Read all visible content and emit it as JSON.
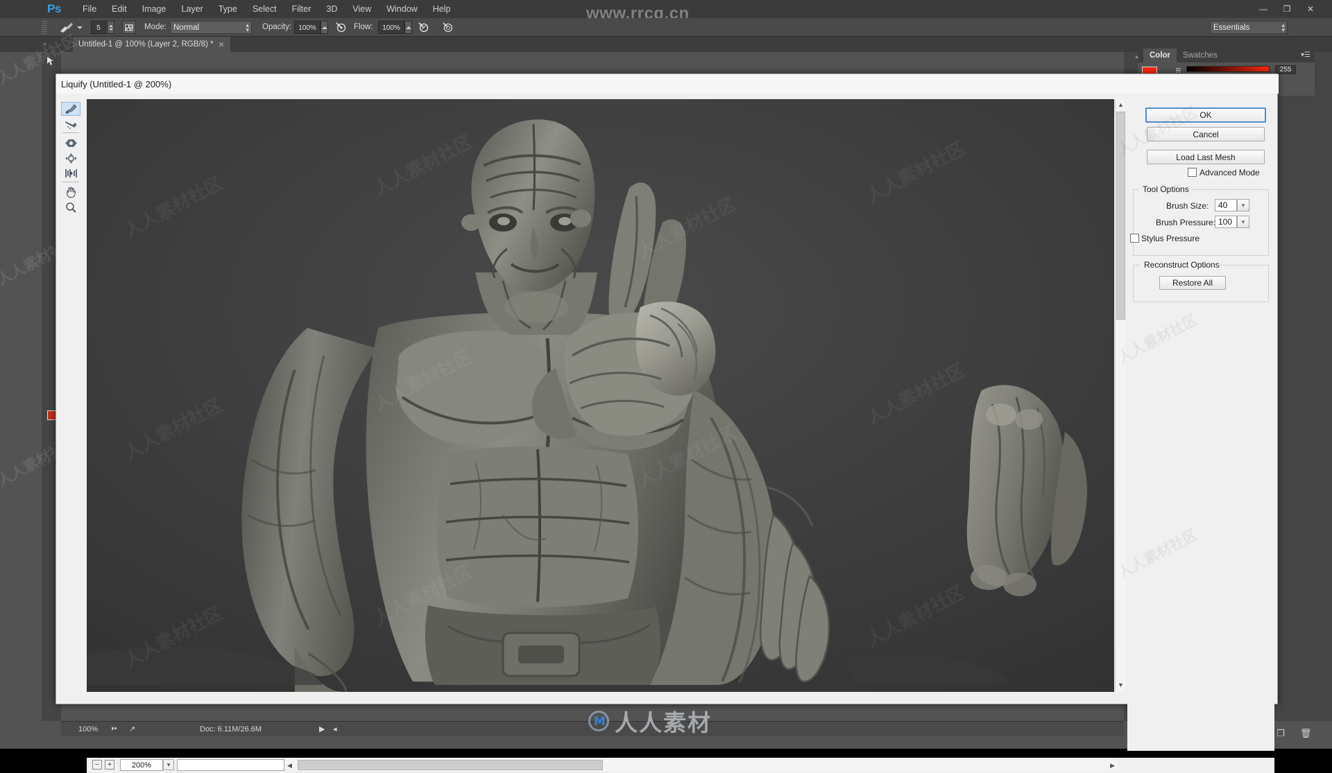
{
  "window": {
    "app_logo": "Ps",
    "controls": {
      "minimize": "—",
      "restore": "❐",
      "close": "✕"
    },
    "workspace_selector": "Essentials"
  },
  "menubar": {
    "items": [
      "File",
      "Edit",
      "Image",
      "Layer",
      "Type",
      "Select",
      "Filter",
      "3D",
      "View",
      "Window",
      "Help"
    ]
  },
  "options_bar": {
    "brush_preset_icon": "brush-icon",
    "brush_size_value": "5",
    "brush_panel_icon": "brush-panel-icon",
    "mode_label": "Mode:",
    "mode_value": "Normal",
    "opacity_label": "Opacity:",
    "opacity_value": "100%",
    "flow_label": "Flow:",
    "flow_value": "100%",
    "airbrush_icon": "airbrush-icon",
    "tablet_opacity_icon": "tablet-pressure-opacity-icon",
    "tablet_size_icon": "tablet-pressure-size-icon"
  },
  "document_tab": {
    "title": "Untitled-1 @ 100% (Layer 2, RGB/8) *",
    "close": "✕"
  },
  "color_panel": {
    "tabs": [
      {
        "label": "Color",
        "active": true
      },
      {
        "label": "Swatches",
        "active": false
      }
    ],
    "channel_label": "R",
    "channel_value": "255",
    "foreground_color": "#fc2a14",
    "background_color": "#ffffff"
  },
  "status_bar": {
    "zoom": "100%",
    "doc_info": "Doc: 6.11M/26.6M"
  },
  "liquify": {
    "title": "Liquify (Untitled-1 @ 200%)",
    "tools": [
      {
        "name": "forward-warp-tool",
        "selected": true
      },
      {
        "name": "reconstruct-tool",
        "selected": false
      },
      {
        "name": "twirl-clockwise-tool",
        "selected": false
      },
      {
        "name": "pucker-bloat-tool",
        "selected": false
      },
      {
        "name": "push-left-tool",
        "selected": false
      },
      {
        "name": "hand-tool",
        "selected": false
      },
      {
        "name": "zoom-tool",
        "selected": false
      }
    ],
    "buttons": {
      "ok": "OK",
      "cancel": "Cancel",
      "load_last_mesh": "Load Last Mesh",
      "restore_all": "Restore All"
    },
    "advanced_mode": {
      "label": "Advanced Mode",
      "checked": false
    },
    "tool_options": {
      "group_title": "Tool Options",
      "brush_size_label": "Brush Size:",
      "brush_size_value": "40",
      "brush_pressure_label": "Brush Pressure:",
      "brush_pressure_value": "100",
      "stylus_pressure_label": "Stylus Pressure",
      "stylus_pressure_checked": false
    },
    "reconstruct_options": {
      "group_title": "Reconstruct Options"
    },
    "zoom_control": {
      "minus": "−",
      "plus": "+",
      "value": "200%",
      "caret": "▾"
    },
    "scrollbars": {
      "v_up": "▲",
      "v_down": "▼",
      "h_left": "◀",
      "h_right": "▶"
    }
  },
  "layers_panel_footer": {
    "icons": [
      "link-icon",
      "fx-icon",
      "mask-icon",
      "adjustment-icon",
      "group-folder-icon",
      "new-layer-icon",
      "delete-layer-icon"
    ]
  },
  "watermarks": {
    "top_url": "www.rrcg.cn",
    "tile_text": "人人素材社区",
    "logo_text": "人人素材"
  },
  "colors": {
    "app_chrome": "#535353",
    "menubar": "#3b3b3b",
    "dialog_bg": "#f0f0f0",
    "canvas_bg": "#3c3c3c",
    "accent_blue": "#4f8fcc",
    "selected_tool_bg": "#cfe3f7"
  }
}
